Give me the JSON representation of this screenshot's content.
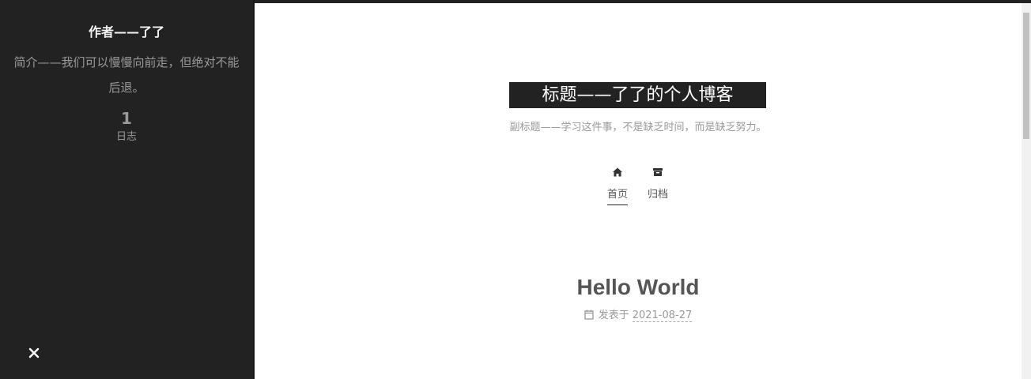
{
  "sidebar": {
    "author": "作者——了了",
    "description": "简介——我们可以慢慢向前走，但绝对不能后退。",
    "state": {
      "count": "1",
      "label": "日志"
    },
    "close_icon": "close-icon"
  },
  "header": {
    "brand_title": "标题——了了的个人博客",
    "subtitle": "副标题——学习这件事，不是缺乏时间，而是缺乏努力。"
  },
  "menu": {
    "items": [
      {
        "label": "首页",
        "icon": "home-icon",
        "active": true
      },
      {
        "label": "归档",
        "icon": "archive-icon",
        "active": false
      }
    ]
  },
  "post": {
    "title": "Hello World",
    "meta_label": "发表于",
    "date": "2021-08-27",
    "date_icon": "calendar-icon"
  },
  "colors": {
    "sidebar_bg": "#222222",
    "brand_bg": "#222222",
    "text_muted": "#999999",
    "text_main": "#555555"
  }
}
